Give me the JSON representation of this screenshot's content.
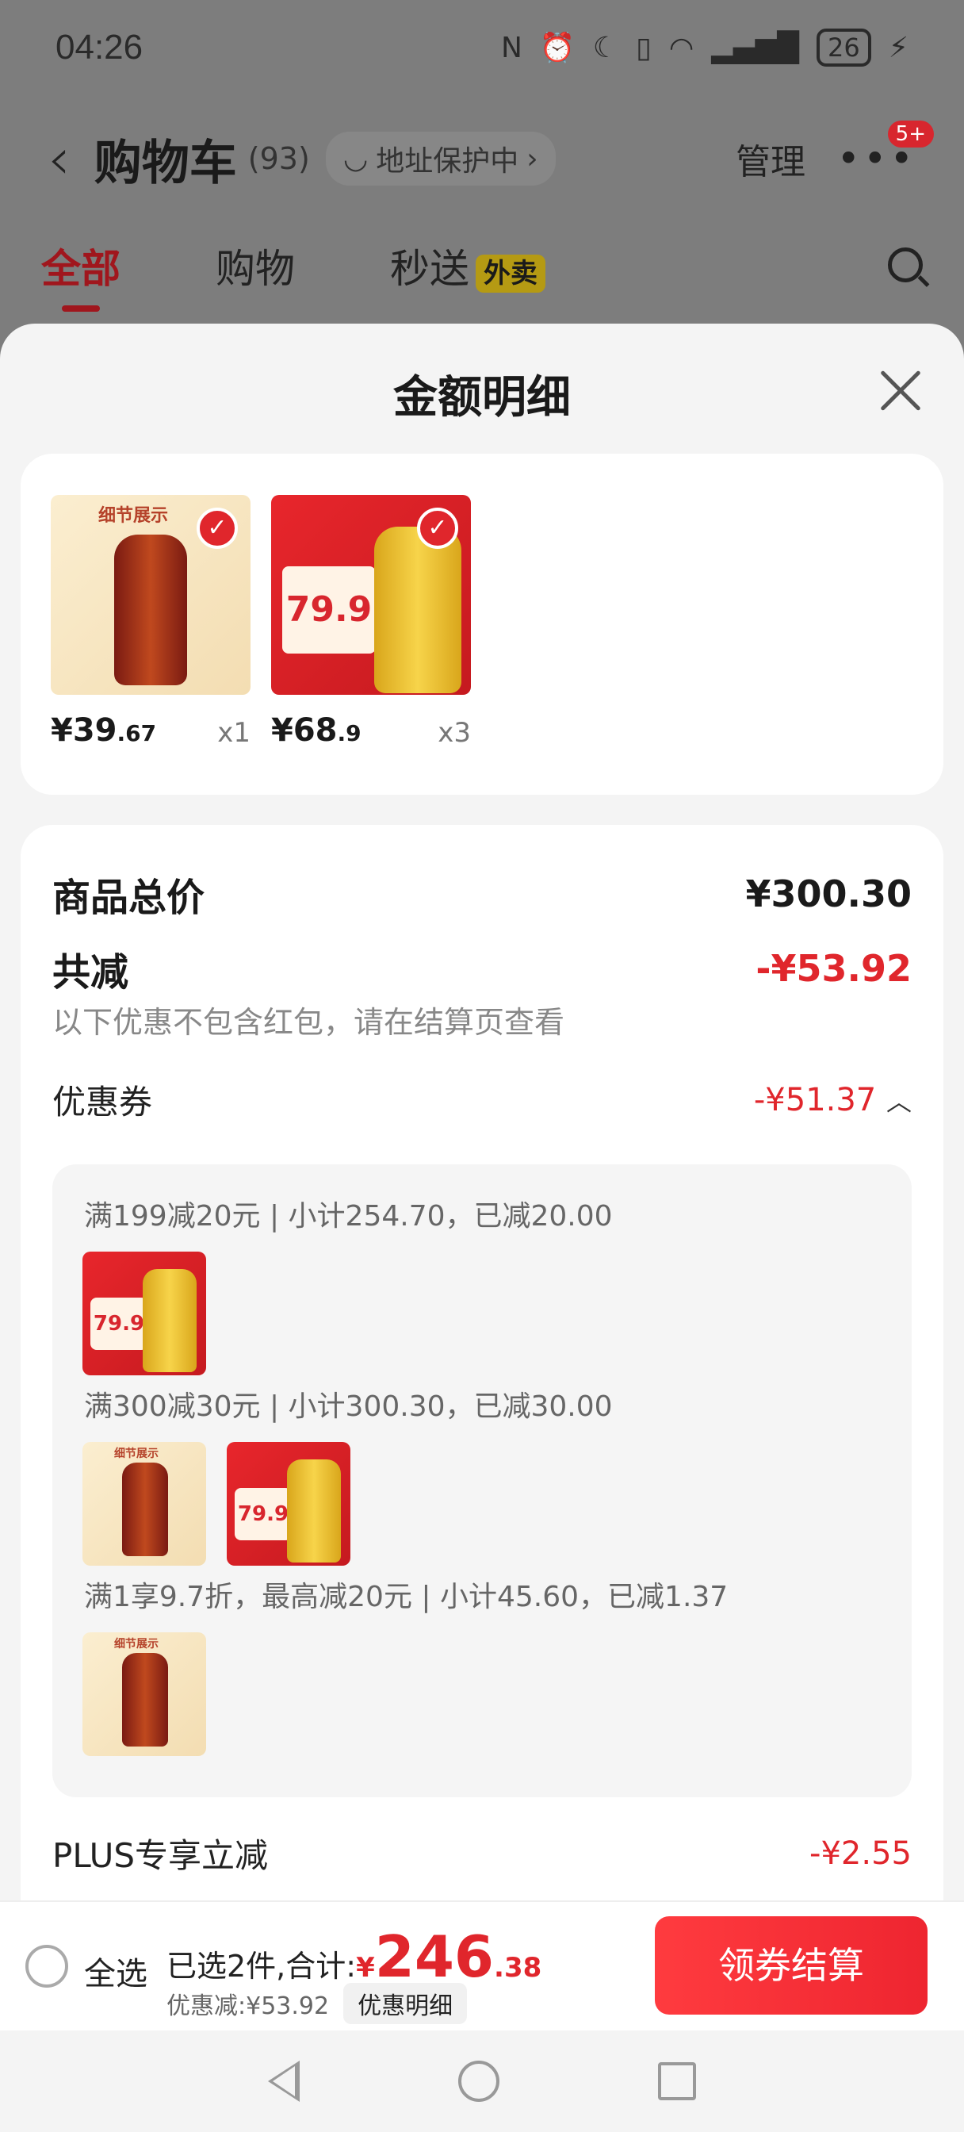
{
  "status_bar": {
    "time": "04:26",
    "battery": "26",
    "icons": [
      "nfc-icon",
      "alarm-icon",
      "moon-icon",
      "vibrate-icon",
      "wifi-icon",
      "signal-icon",
      "battery-icon",
      "charging-icon"
    ]
  },
  "header": {
    "title": "购物车",
    "count": "(93)",
    "address_protect": "地址保护中",
    "manage": "管理",
    "badge": "5+"
  },
  "tabs": [
    {
      "label": "全部"
    },
    {
      "label": "购物"
    },
    {
      "label": "秒送",
      "tag": "外卖"
    }
  ],
  "sheet": {
    "title": "金额明细"
  },
  "products": [
    {
      "price_int": "¥39",
      "price_dec": ".67",
      "qty": "x1",
      "thumb_text": "细节展示"
    },
    {
      "price_int": "¥68",
      "price_dec": ".9",
      "qty": "x3",
      "thumb_text": "79.9"
    }
  ],
  "detail": {
    "total_label": "商品总价",
    "total_value": "¥300.30",
    "reduce_label": "共减",
    "reduce_value": "-¥53.92",
    "reduce_note": "以下优惠不包含红包，请在结算页查看",
    "coupon_label": "优惠券",
    "coupon_value": "-¥51.37",
    "coupons": [
      {
        "text": "满199减20元 | 小计254.70，已减20.00"
      },
      {
        "text": "满300减30元 | 小计300.30，已减30.00"
      },
      {
        "text": "满1享9.7折，最高减20元 | 小计45.60，已减1.37"
      }
    ],
    "plus_label": "PLUS专享立减",
    "plus_value": "-¥2.55"
  },
  "bottom_bar": {
    "select_all": "全选",
    "selected_text": "已选2件,合计:",
    "sum_symbol": "¥",
    "sum_int": "246",
    "sum_dec": ".38",
    "discount_text": "优惠减:¥53.92",
    "discount_detail": "优惠明细",
    "pay_button": "领券结算"
  },
  "colors": {
    "accent": "#e0262c",
    "tab_active": "#a0161d"
  }
}
